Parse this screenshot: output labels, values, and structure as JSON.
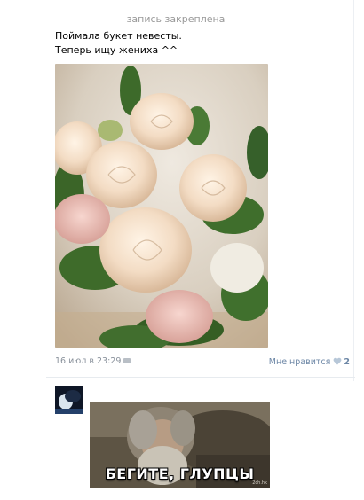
{
  "post": {
    "pinned_label": "запись закреплена",
    "text_line1": "Поймала букет невесты.",
    "text_line2": "Теперь ищу жениха ^^",
    "date": "16 июл в 23:29",
    "like_label": "Мне нравится",
    "like_count": "2"
  },
  "comment": {
    "meme_caption": "БЕГИТЕ, ГЛУПЦЫ",
    "watermark": "2ch.hk"
  },
  "colors": {
    "muted_text": "#999999",
    "link": "#6d87a6",
    "divider": "#e7ebef"
  },
  "icons": [
    "camera-icon",
    "heart-icon"
  ]
}
